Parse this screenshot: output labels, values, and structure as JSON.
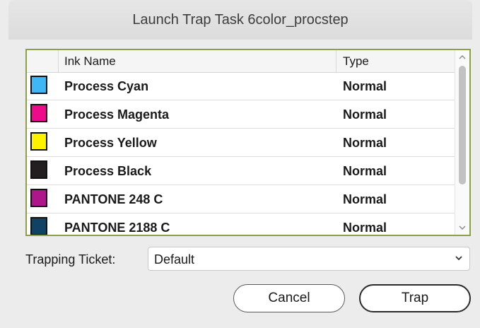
{
  "window": {
    "title": "Launch Trap Task 6color_procstep"
  },
  "table": {
    "columns": {
      "ink_name": "Ink Name",
      "type": "Type"
    },
    "rows": [
      {
        "name": "Process Cyan",
        "type": "Normal",
        "color": "#3fb6f5"
      },
      {
        "name": "Process Magenta",
        "type": "Normal",
        "color": "#ee0a8b"
      },
      {
        "name": "Process Yellow",
        "type": "Normal",
        "color": "#fff200"
      },
      {
        "name": "Process Black",
        "type": "Normal",
        "color": "#231f20"
      },
      {
        "name": "PANTONE 248 C",
        "type": "Normal",
        "color": "#b0168b"
      },
      {
        "name": "PANTONE 2188 C",
        "type": "Normal",
        "color": "#0f4265"
      }
    ],
    "selection_color": "#8ca046"
  },
  "trapping_ticket": {
    "label": "Trapping Ticket:",
    "value": "Default",
    "chevron_icon": "chevron-down-icon"
  },
  "buttons": {
    "cancel": "Cancel",
    "trap": "Trap"
  },
  "scrollbar": {
    "up_icon": "chevron-up-icon",
    "down_icon": "chevron-down-icon"
  }
}
